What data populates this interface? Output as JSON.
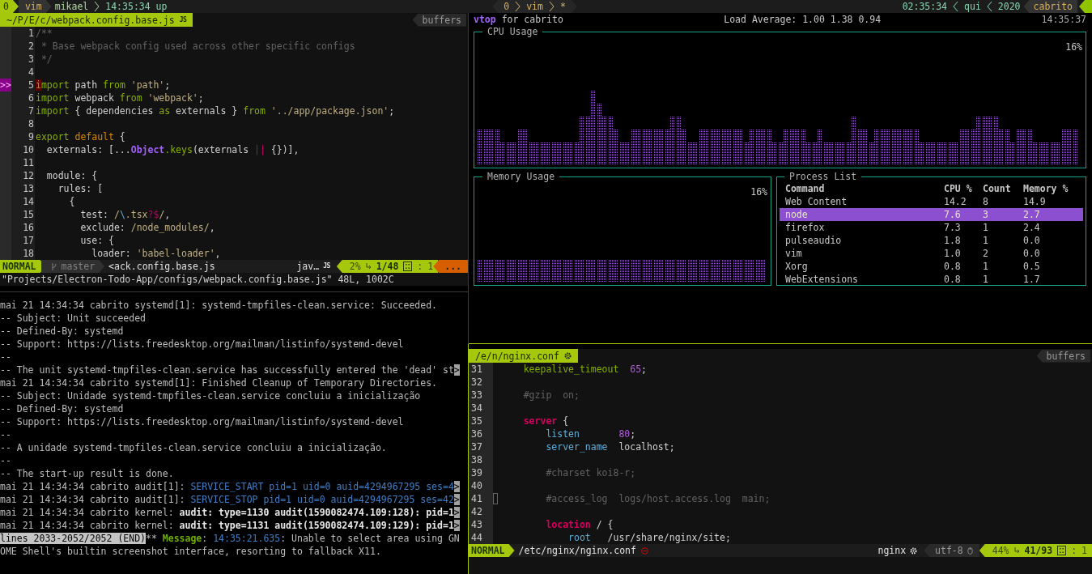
{
  "tmux_bar": {
    "left": {
      "session": "0",
      "window": "vim",
      "user": "mikael",
      "uptime": "14:35:34 up"
    },
    "center": {
      "session": "0",
      "window": "vim",
      "flag": "*"
    },
    "right": {
      "time": "02:35:34",
      "day": "qui",
      "year": "2020",
      "host": "cabrito"
    }
  },
  "left_editor": {
    "tab": {
      "path": "~/P/E/c/webpack.config.base.js",
      "badge": "JS",
      "buffers": "buffers"
    },
    "lines": [
      {
        "number": "1",
        "segments": [
          {
            "kind": "comment",
            "text": "/**"
          }
        ]
      },
      {
        "number": "2",
        "segments": [
          {
            "kind": "comment",
            "text": " * Base webpack config used across other specific configs"
          }
        ]
      },
      {
        "number": "3",
        "segments": [
          {
            "kind": "comment",
            "text": " */"
          }
        ]
      },
      {
        "number": "4"
      },
      {
        "number": "5",
        "sign": ">>",
        "segments": [
          {
            "kind": "cursor",
            "text": "i"
          },
          {
            "kind": "keyword",
            "text": "mport"
          },
          {
            "kind": "plain",
            "text": " path "
          },
          {
            "kind": "keyword",
            "text": "from"
          },
          {
            "kind": "string",
            "text": " 'path'"
          },
          {
            "kind": "plain",
            "text": ";"
          }
        ]
      },
      {
        "number": "6",
        "segments": [
          {
            "kind": "keyword",
            "text": "import"
          },
          {
            "kind": "plain",
            "text": " webpack "
          },
          {
            "kind": "keyword",
            "text": "from"
          },
          {
            "kind": "string",
            "text": " 'webpack'"
          },
          {
            "kind": "plain",
            "text": ";"
          }
        ]
      },
      {
        "number": "7",
        "segments": [
          {
            "kind": "keyword",
            "text": "import"
          },
          {
            "kind": "plain",
            "text": " { dependencies "
          },
          {
            "kind": "keyword",
            "text": "as"
          },
          {
            "kind": "plain",
            "text": " externals } "
          },
          {
            "kind": "keyword",
            "text": "from"
          },
          {
            "kind": "string",
            "text": " '../app/package.json'"
          },
          {
            "kind": "plain",
            "text": ";"
          }
        ]
      },
      {
        "number": "8"
      },
      {
        "number": "9",
        "segments": [
          {
            "kind": "keyword",
            "text": "export"
          },
          {
            "kind": "special",
            "text": " default"
          },
          {
            "kind": "plain",
            "text": " {"
          }
        ]
      },
      {
        "number": "10",
        "segments": [
          {
            "kind": "plain",
            "text": "  externals: [..."
          },
          {
            "kind": "type",
            "text": "Object"
          },
          {
            "kind": "keyword",
            "text": ".keys"
          },
          {
            "kind": "plain",
            "text": "(externals "
          },
          {
            "kind": "operator",
            "text": "||"
          },
          {
            "kind": "plain",
            "text": " {})],"
          }
        ]
      },
      {
        "number": "11"
      },
      {
        "number": "12",
        "segments": [
          {
            "kind": "plain",
            "text": "  module: {"
          }
        ]
      },
      {
        "number": "13",
        "segments": [
          {
            "kind": "plain",
            "text": "    rules: ["
          }
        ]
      },
      {
        "number": "14",
        "segments": [
          {
            "kind": "plain",
            "text": "      {"
          }
        ]
      },
      {
        "number": "15",
        "segments": [
          {
            "kind": "plain",
            "text": "        test: "
          },
          {
            "kind": "string",
            "text": "/"
          },
          {
            "kind": "escape",
            "text": "\\"
          },
          {
            "kind": "string",
            "text": ".tsx"
          },
          {
            "kind": "operator",
            "text": "?$"
          },
          {
            "kind": "string",
            "text": "/"
          },
          {
            "kind": "plain",
            "text": ","
          }
        ]
      },
      {
        "number": "16",
        "segments": [
          {
            "kind": "plain",
            "text": "        exclude: "
          },
          {
            "kind": "string",
            "text": "/node_modules/"
          },
          {
            "kind": "plain",
            "text": ","
          }
        ]
      },
      {
        "number": "17",
        "segments": [
          {
            "kind": "plain",
            "text": "        use: {"
          }
        ]
      },
      {
        "number": "18",
        "segments": [
          {
            "kind": "plain",
            "text": "          loader: "
          },
          {
            "kind": "string",
            "text": "'babel-loader'"
          },
          {
            "kind": "plain",
            "text": ","
          }
        ]
      }
    ],
    "status": {
      "mode": "NORMAL",
      "branch": "master",
      "filename": "<ack.config.base.js",
      "readonly": false,
      "filetype": "jav…",
      "filetype_badge": "JS",
      "percent": "2%",
      "position": "1/48",
      "column_separator": ":",
      "column": "1",
      "warnings": "..."
    },
    "command_line": "\"Projects/Electron-Todo-App/configs/webpack.config.base.js\" 48L, 1002C"
  },
  "log": {
    "lines": [
      {
        "segments": [
          {
            "kind": "plain",
            "text": "mai 21 14:34:34 cabrito systemd[1]: systemd-tmpfiles-clean.service: Succeeded."
          }
        ]
      },
      {
        "segments": [
          {
            "kind": "plain",
            "text": "-- Subject: Unit succeeded"
          }
        ]
      },
      {
        "segments": [
          {
            "kind": "plain",
            "text": "-- Defined-By: systemd"
          }
        ]
      },
      {
        "segments": [
          {
            "kind": "plain",
            "text": "-- Support: https://lists.freedesktop.org/mailman/listinfo/systemd-devel"
          }
        ]
      },
      {
        "segments": [
          {
            "kind": "plain",
            "text": "--"
          }
        ]
      },
      {
        "segments": [
          {
            "kind": "plain",
            "text": "-- The unit systemd-tmpfiles-clean.service has successfully entered the 'dead' st"
          },
          {
            "kind": "more",
            "text": ">"
          }
        ]
      },
      {
        "segments": [
          {
            "kind": "plain",
            "text": "mai 21 14:34:34 cabrito systemd[1]: Finished Cleanup of Temporary Directories."
          }
        ]
      },
      {
        "segments": [
          {
            "kind": "plain",
            "text": "-- Subject: Unidade systemd-tmpfiles-clean.service concluiu a inicialização"
          }
        ]
      },
      {
        "segments": [
          {
            "kind": "plain",
            "text": "-- Defined-By: systemd"
          }
        ]
      },
      {
        "segments": [
          {
            "kind": "plain",
            "text": "-- Support: https://lists.freedesktop.org/mailman/listinfo/systemd-devel"
          }
        ]
      },
      {
        "segments": [
          {
            "kind": "plain",
            "text": "--"
          }
        ]
      },
      {
        "segments": [
          {
            "kind": "plain",
            "text": "-- A unidade systemd-tmpfiles-clean.service concluiu a inicialização."
          }
        ]
      },
      {
        "segments": [
          {
            "kind": "plain",
            "text": "--"
          }
        ]
      },
      {
        "segments": [
          {
            "kind": "plain",
            "text": "-- The start-up result is done."
          }
        ]
      },
      {
        "segments": [
          {
            "kind": "plain",
            "text": "mai 21 14:34:34 cabrito audit[1]: "
          },
          {
            "kind": "highlight",
            "text": "SERVICE_START pid=1 uid=0 auid=4294967295 ses=4"
          },
          {
            "kind": "more",
            "text": ">"
          }
        ]
      },
      {
        "segments": [
          {
            "kind": "plain",
            "text": "mai 21 14:34:34 cabrito audit[1]: "
          },
          {
            "kind": "highlight",
            "text": "SERVICE_STOP pid=1 uid=0 auid=4294967295 ses=42"
          },
          {
            "kind": "more",
            "text": ">"
          }
        ]
      },
      {
        "segments": [
          {
            "kind": "plain",
            "text": "mai 21 14:34:34 cabrito kernel: "
          },
          {
            "kind": "bold",
            "text": "audit: type=1130 audit(1590082474.109:128): pid=1"
          },
          {
            "kind": "more",
            "text": ">"
          }
        ]
      },
      {
        "segments": [
          {
            "kind": "plain",
            "text": "mai 21 14:34:34 cabrito kernel: "
          },
          {
            "kind": "bold",
            "text": "audit: type=1131 audit(1590082474.109:129): pid=1"
          },
          {
            "kind": "more",
            "text": ">"
          }
        ]
      },
      {
        "segments": [
          {
            "kind": "pager",
            "text": "lines 2033-2052/2052 (END)"
          },
          {
            "kind": "plain",
            "text": "** "
          },
          {
            "kind": "label",
            "text": "Message"
          },
          {
            "kind": "plain",
            "text": ": "
          },
          {
            "kind": "highlight",
            "text": "14:35:21.635"
          },
          {
            "kind": "plain",
            "text": ": Unable to select area using GN"
          }
        ]
      },
      {
        "segments": [
          {
            "kind": "plain",
            "text": "OME Shell's builtin screenshot interface, resorting to fallback X11."
          }
        ]
      }
    ]
  },
  "vtop": {
    "app": "vtop",
    "host_label": "for cabrito",
    "load_average": "Load Average: 1.00 1.38 0.94",
    "clock": "14:35:37",
    "cpu_panel": {
      "title": "CPU Usage",
      "reading": "16%"
    },
    "memory_panel": {
      "title": "Memory Usage",
      "reading": "16%"
    },
    "process_list": {
      "title": "Process List",
      "columns": [
        "Command",
        "CPU %",
        "Count",
        "Memory %"
      ],
      "rows": [
        {
          "cells": [
            "Web Content",
            "14.2",
            "8",
            "14.9"
          ],
          "selected": false
        },
        {
          "cells": [
            "node",
            "7.6",
            "3",
            "2.7"
          ],
          "selected": true
        },
        {
          "cells": [
            "firefox",
            "7.3",
            "1",
            "2.4"
          ],
          "selected": false
        },
        {
          "cells": [
            "pulseaudio",
            "1.8",
            "1",
            "0.0"
          ],
          "selected": false
        },
        {
          "cells": [
            "vim",
            "1.0",
            "2",
            "0.0"
          ],
          "selected": false
        },
        {
          "cells": [
            "Xorg",
            "0.8",
            "1",
            "0.5"
          ],
          "selected": false
        },
        {
          "cells": [
            "WebExtensions",
            "0.8",
            "1",
            "1.7"
          ],
          "selected": false
        }
      ]
    }
  },
  "right_editor": {
    "tab": {
      "path": "/e/n/nginx.conf",
      "buffers": "buffers"
    },
    "lines": [
      {
        "number": "31",
        "marked": false,
        "segments": [
          {
            "kind": "keyword",
            "text": "    keepalive_timeout"
          },
          {
            "kind": "number",
            "text": "  65"
          },
          {
            "kind": "plain",
            "text": ";"
          }
        ]
      },
      {
        "number": "32",
        "marked": false
      },
      {
        "number": "33",
        "marked": false,
        "segments": [
          {
            "kind": "comment",
            "text": "    #gzip  on;"
          }
        ]
      },
      {
        "number": "34",
        "marked": false
      },
      {
        "number": "35",
        "marked": false,
        "segments": [
          {
            "kind": "block",
            "text": "    server"
          },
          {
            "kind": "plain",
            "text": " {"
          }
        ]
      },
      {
        "number": "36",
        "marked": false,
        "segments": [
          {
            "kind": "directive",
            "text": "        listen"
          },
          {
            "kind": "number",
            "text": "       80"
          },
          {
            "kind": "plain",
            "text": ";"
          }
        ]
      },
      {
        "number": "37",
        "marked": false,
        "segments": [
          {
            "kind": "directive",
            "text": "        server_name"
          },
          {
            "kind": "plain",
            "text": "  localhost;"
          }
        ]
      },
      {
        "number": "38",
        "marked": false
      },
      {
        "number": "39",
        "marked": false,
        "segments": [
          {
            "kind": "comment",
            "text": "        #charset koi8-r;"
          }
        ]
      },
      {
        "number": "40",
        "marked": false
      },
      {
        "number": "41",
        "marked": true,
        "segments": [
          {
            "kind": "comment",
            "text": "        #access_log  logs/host.access.log  main;"
          }
        ]
      },
      {
        "number": "42",
        "marked": false
      },
      {
        "number": "43",
        "marked": false,
        "segments": [
          {
            "kind": "block",
            "text": "        location"
          },
          {
            "kind": "plain",
            "text": " / {"
          }
        ]
      },
      {
        "number": "44",
        "marked": false,
        "segments": [
          {
            "kind": "directive",
            "text": "            root"
          },
          {
            "kind": "plain",
            "text": "   /usr/share/nginx/site;"
          }
        ]
      }
    ],
    "status": {
      "mode": "NORMAL",
      "filename": "/etc/nginx/nginx.conf",
      "readonly": true,
      "filetype": "nginx",
      "encoding": "utf-8",
      "percent": "44%",
      "position": "41/93",
      "column_separator": ":",
      "column": "1"
    }
  }
}
